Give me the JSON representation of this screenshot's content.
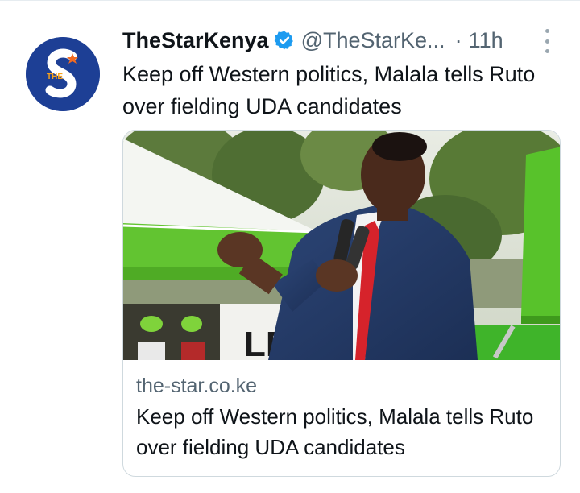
{
  "tweet": {
    "author_name": "TheStarKenya",
    "handle": "@TheStarKe...",
    "separator": "·",
    "time": "11h",
    "text": "Keep off Western politics, Malala tells Ruto over fielding UDA candidates",
    "verified": true,
    "avatar": {
      "icon": "the-star-logo",
      "letter": "S",
      "small_text": "THE",
      "background": "#1d3f95",
      "accent": "#f26b21"
    }
  },
  "card": {
    "domain": "the-star.co.ke",
    "title": "Keep off Western politics, Malala tells Ruto over fielding UDA candidates",
    "banner_text": "LEO MAI"
  },
  "colors": {
    "verified_blue": "#1d9bf0",
    "muted_text": "#536471",
    "border": "#cfd9de"
  },
  "icons": {
    "verified": "verified-badge-icon",
    "more": "more-options-icon"
  }
}
